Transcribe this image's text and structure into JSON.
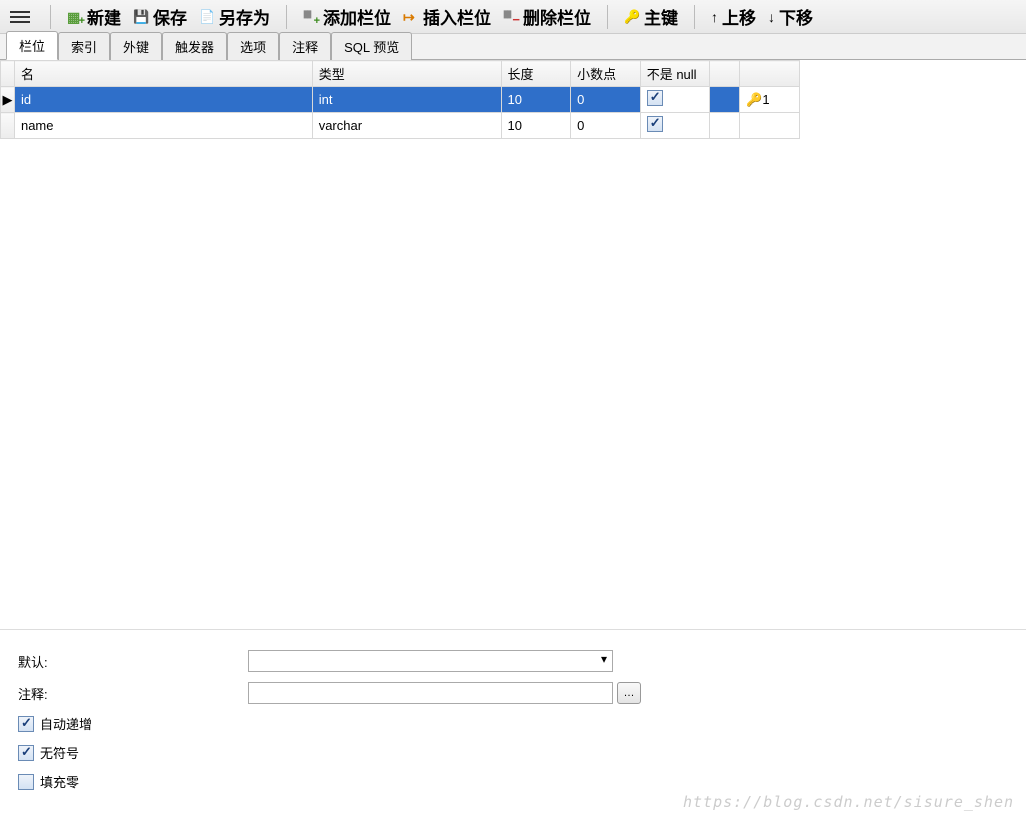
{
  "toolbar": {
    "new": "新建",
    "save": "保存",
    "saveas": "另存为",
    "addfield": "添加栏位",
    "insertfield": "插入栏位",
    "deletefield": "删除栏位",
    "primarykey": "主键",
    "moveup": "上移",
    "movedown": "下移"
  },
  "tabs": [
    "栏位",
    "索引",
    "外键",
    "触发器",
    "选项",
    "注释",
    "SQL 预览"
  ],
  "active_tab": 0,
  "columns": {
    "name": "名",
    "type": "类型",
    "length": "长度",
    "decimals": "小数点",
    "notnull": "不是 null"
  },
  "rows": [
    {
      "name": "id",
      "type": "int",
      "length": "10",
      "decimals": "0",
      "notnull": true,
      "selected": true,
      "key": "1"
    },
    {
      "name": "name",
      "type": "varchar",
      "length": "10",
      "decimals": "0",
      "notnull": true,
      "selected": false,
      "key": ""
    }
  ],
  "bottom": {
    "default_label": "默认:",
    "default_value": "",
    "comment_label": "注释:",
    "comment_value": "",
    "auto_increment": {
      "label": "自动递增",
      "checked": true
    },
    "unsigned": {
      "label": "无符号",
      "checked": true
    },
    "zerofill": {
      "label": "填充零",
      "checked": false
    }
  },
  "watermark": "https://blog.csdn.net/sisure_shen"
}
